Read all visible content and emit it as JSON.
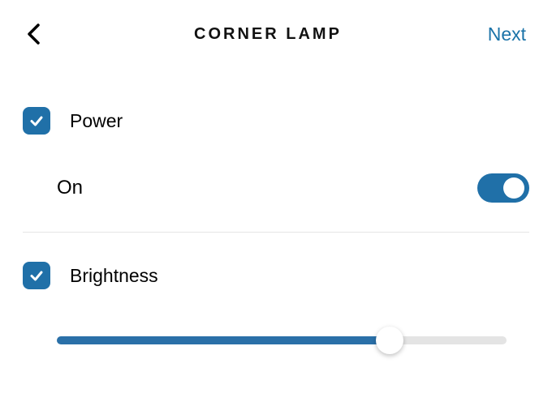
{
  "header": {
    "title": "CORNER LAMP",
    "next_label": "Next"
  },
  "power": {
    "label": "Power",
    "checked": true,
    "state_label": "On",
    "toggle_on": true
  },
  "brightness": {
    "label": "Brightness",
    "checked": true,
    "slider_value_percent": 74
  },
  "colors": {
    "accent": "#2070a8"
  }
}
